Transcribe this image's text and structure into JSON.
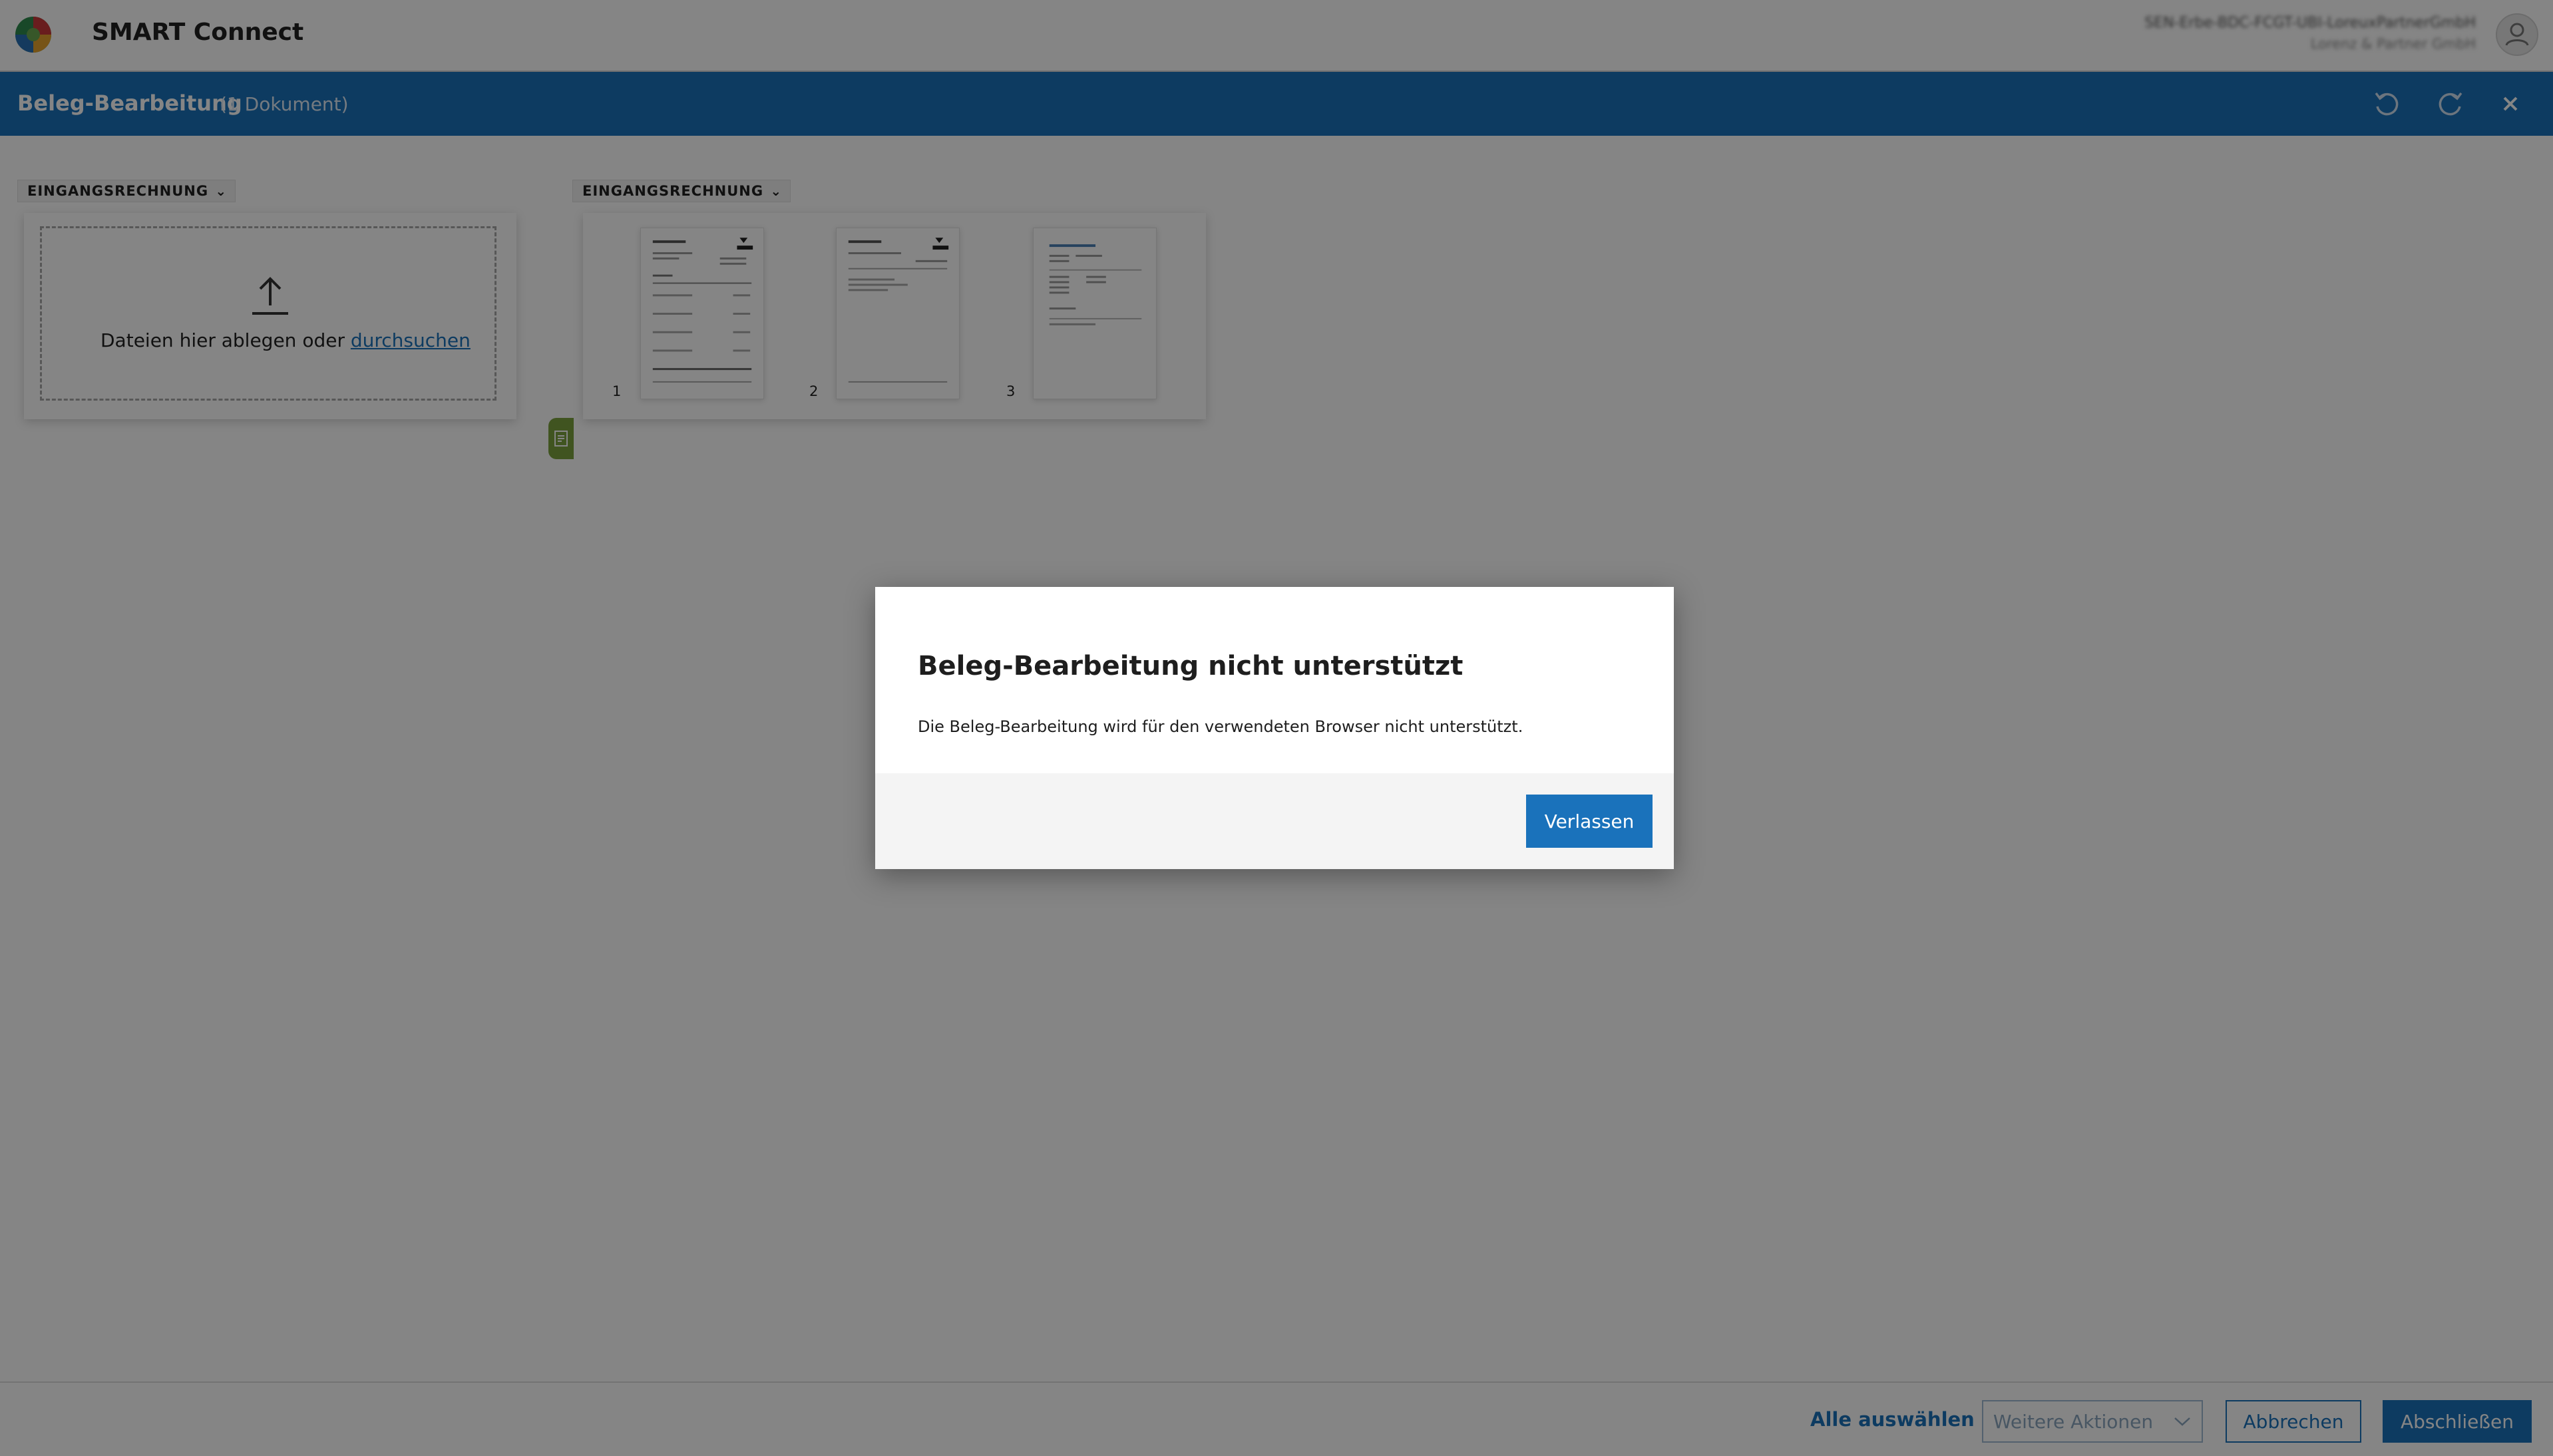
{
  "app": {
    "title": "SMART Connect",
    "user_name": "SEN-Erbe-BDC-FCGT-UBI-LoreuxPartnerGmbH",
    "user_company": "Lorenz & Partner GmbH"
  },
  "header": {
    "title": "Beleg-Bearbeitung",
    "count": "(1 Dokument)"
  },
  "groups": [
    {
      "label": "EINGANGSRECHNUNG",
      "dropzone": {
        "text": "Dateien hier ablegen oder",
        "link": "durchsuchen"
      }
    },
    {
      "label": "EINGANGSRECHNUNG",
      "pages": [
        {
          "number": "1"
        },
        {
          "number": "2"
        },
        {
          "number": "3"
        }
      ]
    }
  ],
  "footer": {
    "select_all": "Alle auswählen",
    "more_actions": "Weitere Aktionen",
    "cancel": "Abbrechen",
    "finish": "Abschließen"
  },
  "modal": {
    "title": "Beleg-Bearbeitung nicht unterstützt",
    "message": "Die Beleg-Bearbeitung wird für den verwendeten Browser nicht unterstützt.",
    "button": "Verlassen"
  },
  "colors": {
    "brand_blue": "#1a72bb",
    "accent_green": "#7ba23f",
    "overlay": "rgba(0,0,0,0.48)"
  },
  "icons": [
    "logo-icon",
    "user-avatar-icon",
    "undo-icon",
    "redo-icon",
    "close-icon",
    "chevron-down-icon",
    "upload-icon",
    "page-list-icon",
    "split-icon"
  ]
}
